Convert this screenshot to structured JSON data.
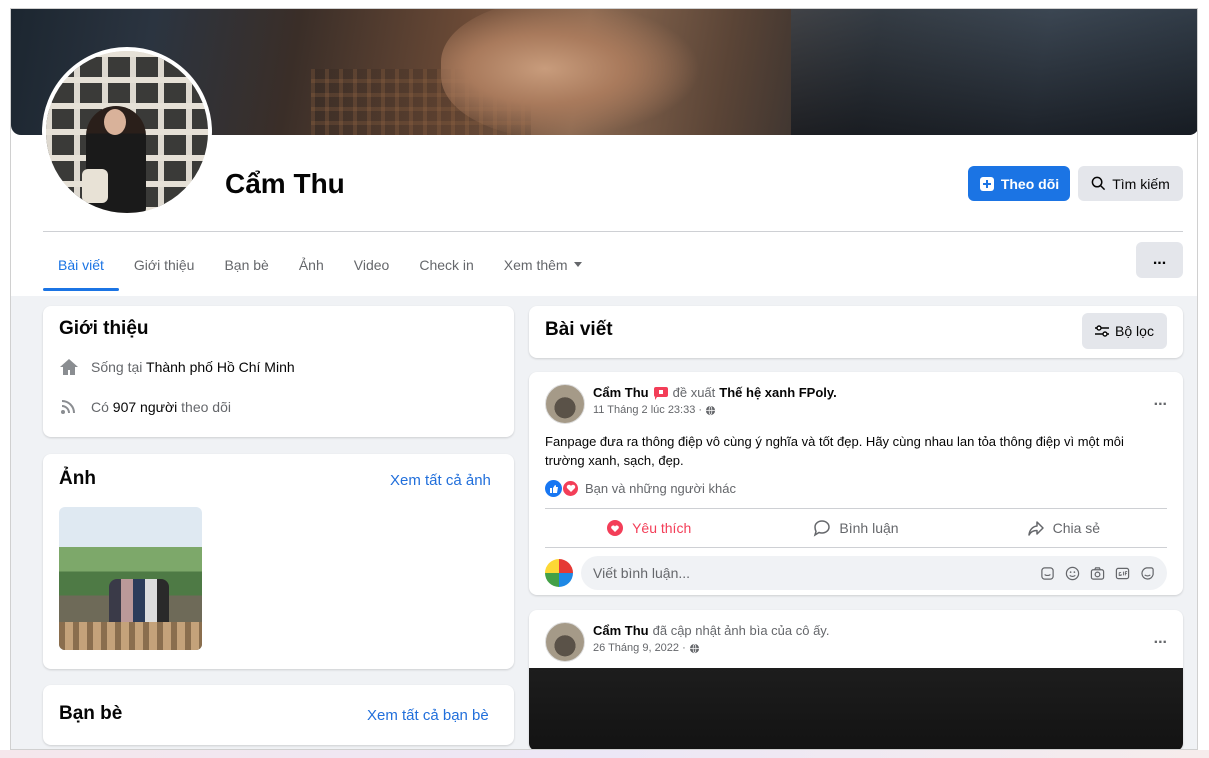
{
  "profile": {
    "name": "Cẩm Thu",
    "follow_label": "Theo dõi",
    "search_label": "Tìm kiếm",
    "more_label": "..."
  },
  "tabs": [
    {
      "label": "Bài viết",
      "active": true
    },
    {
      "label": "Giới thiệu"
    },
    {
      "label": "Bạn bè"
    },
    {
      "label": "Ảnh"
    },
    {
      "label": "Video"
    },
    {
      "label": "Check in"
    },
    {
      "label": "Xem thêm"
    }
  ],
  "intro": {
    "title": "Giới thiệu",
    "lives_prefix": "Sống tại",
    "lives_place": "Thành phố Hồ Chí Minh",
    "followers_prefix": "Có",
    "followers_count": "907 người",
    "followers_suffix": "theo dõi"
  },
  "photos": {
    "title": "Ảnh",
    "see_all": "Xem tất cả ảnh"
  },
  "friends": {
    "title": "Bạn bè",
    "see_all": "Xem tất cả bạn bè"
  },
  "posts_section": {
    "title": "Bài viết",
    "filter_label": "Bộ lọc"
  },
  "posts": [
    {
      "author": "Cẩm Thu",
      "action": "đề xuất",
      "target": "Thế hệ xanh FPoly.",
      "time": "11 Tháng 2 lúc 23:33 ·",
      "text": "Fanpage đưa ra thông điệp vô cùng ý nghĩa và tốt đẹp. Hãy cùng nhau lan tỏa thông điệp vì một môi trường xanh, sạch, đẹp.",
      "reactions": "Bạn và những người khác",
      "like_label": "Yêu thích",
      "comment_label": "Bình luận",
      "share_label": "Chia sẻ",
      "comment_placeholder": "Viết bình luận..."
    },
    {
      "author": "Cẩm Thu",
      "action": "đã cập nhật ảnh bìa của cô ấy.",
      "time": "26 Tháng 9, 2022 ·"
    }
  ],
  "colors": {
    "accent": "#1b74e4",
    "love": "#f33e58",
    "background": "#f0f2f5"
  },
  "icons": {
    "follow": "plus-square-icon",
    "search": "search-icon",
    "home": "home-icon",
    "followers": "rss-icon",
    "filter": "sliders-icon",
    "recommend": "flag-icon",
    "globe": "globe-icon",
    "like": "thumbs-up-icon",
    "love": "heart-icon",
    "comment": "speech-bubble-icon",
    "share": "share-arrow-icon"
  }
}
